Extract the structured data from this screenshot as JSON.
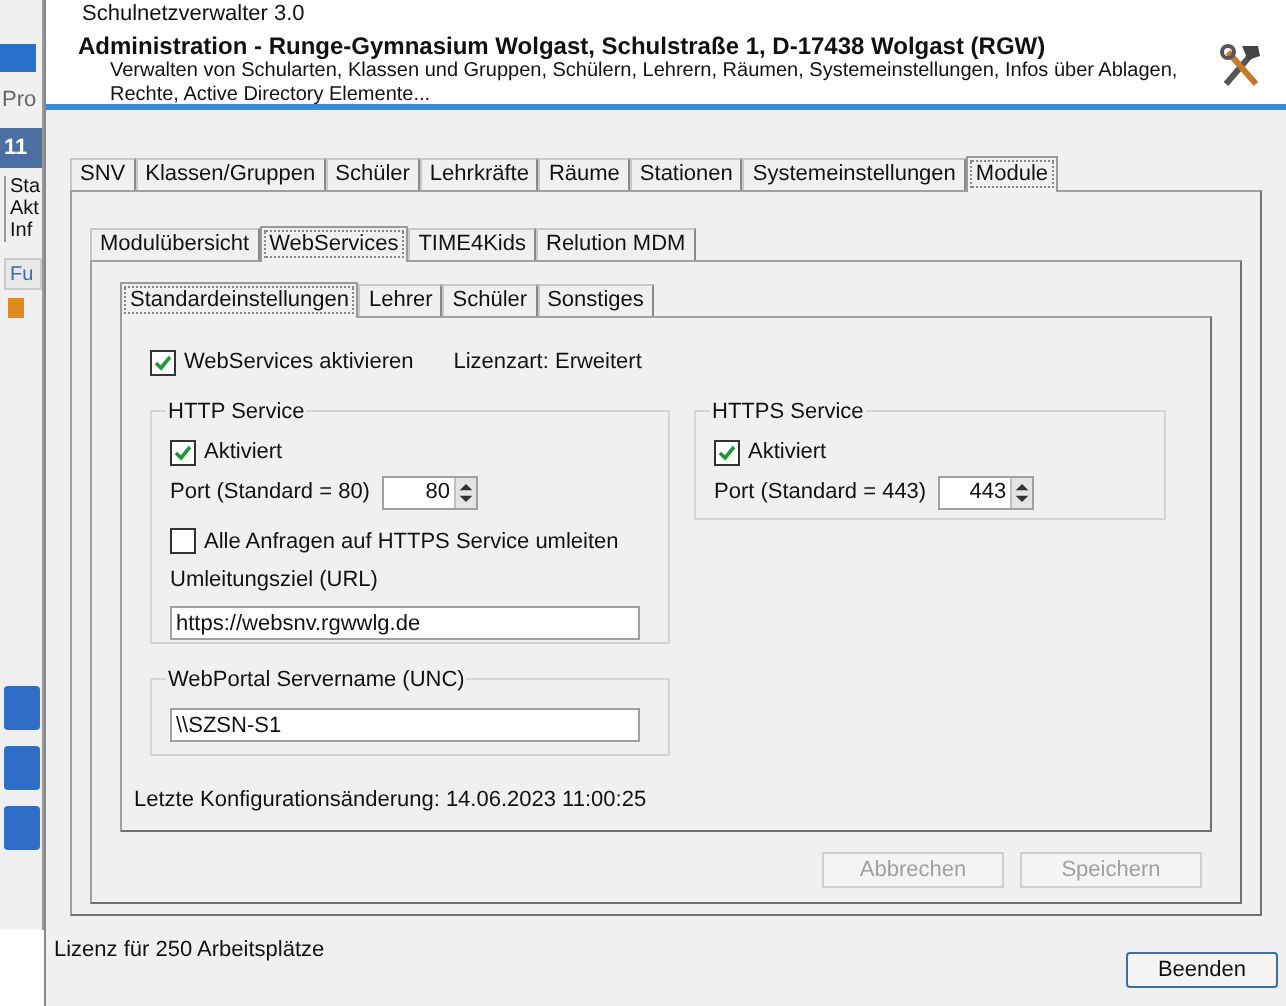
{
  "background_window": {
    "title_fragment": "Pro",
    "tab_fragment": "11",
    "lines": [
      "Sta",
      "Akt",
      "Inf"
    ],
    "column_fragment": "Fu"
  },
  "window": {
    "title": "Schulnetzverwalter 3.0"
  },
  "header": {
    "title": "Administration - Runge-Gymnasium Wolgast, Schulstraße 1, D-17438 Wolgast (RGW)",
    "description": "Verwalten von Schularten, Klassen und Gruppen, Schülern, Lehrern, Räumen, Systemeinstellungen, Infos über Ablagen, Rechte, Active Directory Elemente..."
  },
  "module_tabs": [
    {
      "label": "SNV",
      "selected": false
    },
    {
      "label": "Klassen/Gruppen",
      "selected": false
    },
    {
      "label": "Schüler",
      "selected": false
    },
    {
      "label": "Lehrkräfte",
      "selected": false
    },
    {
      "label": "Räume",
      "selected": false
    },
    {
      "label": "Stationen",
      "selected": false
    },
    {
      "label": "Systemeinstellungen",
      "selected": false
    },
    {
      "label": "Module",
      "selected": true
    }
  ],
  "sub_tabs": [
    {
      "label": "Modulübersicht",
      "selected": false
    },
    {
      "label": "WebServices",
      "selected": true
    },
    {
      "label": "TIME4Kids",
      "selected": false
    },
    {
      "label": "Relution MDM",
      "selected": false
    }
  ],
  "settings_tabs": [
    {
      "label": "Standardeinstellungen",
      "selected": true
    },
    {
      "label": "Lehrer",
      "selected": false
    },
    {
      "label": "Schüler",
      "selected": false
    },
    {
      "label": "Sonstiges",
      "selected": false
    }
  ],
  "webservices": {
    "label": "WebServices aktivieren",
    "checked": true
  },
  "license_type": "Lizenzart: Erweitert",
  "http_service": {
    "title": "HTTP Service",
    "activated": {
      "label": "Aktiviert",
      "checked": true
    },
    "port_label": "Port (Standard = 80)",
    "port": "80",
    "redirect": {
      "label": "Alle Anfragen auf HTTPS Service umleiten",
      "checked": false
    },
    "redirect_target_label": "Umleitungsziel (URL)",
    "redirect_target": "https://websnv.rgwwlg.de"
  },
  "https_service": {
    "title": "HTTPS Service",
    "activated": {
      "label": "Aktiviert",
      "checked": true
    },
    "port_label": "Port (Standard = 443)",
    "port": "443"
  },
  "webportal": {
    "title": "WebPortal Servername (UNC)",
    "value": "\\\\SZSN-S1"
  },
  "last_change": "Letzte Konfigurationsänderung: 14.06.2023 11:00:25",
  "buttons": [
    {
      "label": "Abbrechen",
      "disabled": true
    },
    {
      "label": "Speichern",
      "disabled": true
    }
  ],
  "status": "Lizenz für 250 Arbeitsplätze",
  "close_button": "Beenden"
}
